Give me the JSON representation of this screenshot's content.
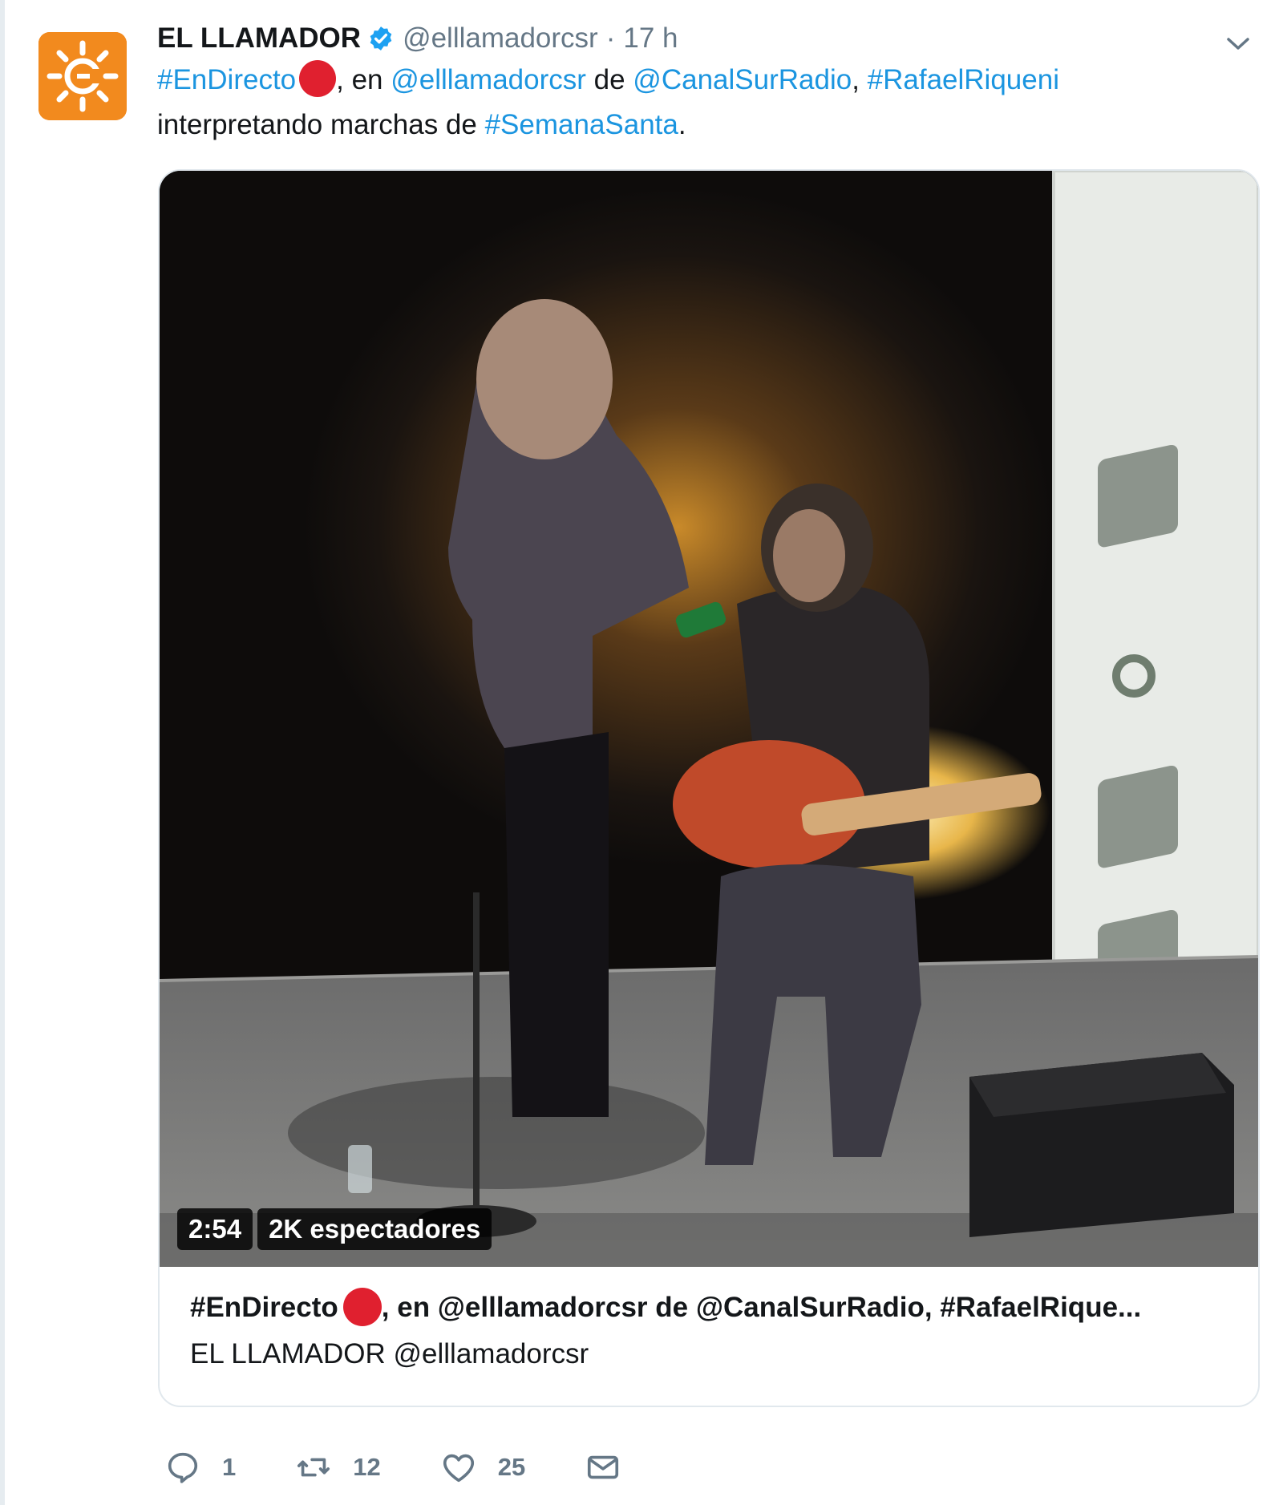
{
  "author": {
    "name": "EL LLAMADOR",
    "handle": "@elllamadorcsr",
    "time": "17 h",
    "separator": "·",
    "avatar_icon": "canal-sur-sun-logo-icon",
    "brand_color": "#f28a1e",
    "verified_color": "#1da1f2"
  },
  "tweet": {
    "hashtag_live": "#EnDirecto",
    "t1": ", en ",
    "mention_program": "@elllamadorcsr",
    "t2": " de ",
    "mention_station": "@CanalSurRadio",
    "t3": ", ",
    "hashtag_artist": "#RafaelRiqueni",
    "t4": "interpretando marchas de ",
    "hashtag_event": "#SemanaSanta",
    "t5": ".",
    "link_color": "#1b95e0",
    "live_dot_color": "#e0202f"
  },
  "video": {
    "duration": "2:54",
    "viewers": "2K espectadores"
  },
  "card": {
    "title_prefix": "#EnDirecto",
    "title_rest": ", en @elllamadorcsr de @CanalSurRadio, #RafaelRique...",
    "source": "EL LLAMADOR @elllamadorcsr"
  },
  "actions": {
    "replies": "1",
    "retweets": "12",
    "likes": "25"
  },
  "icons": {
    "reply": "reply-icon",
    "retweet": "retweet-icon",
    "like": "heart-icon",
    "dm": "envelope-icon",
    "more": "chevron-down-icon"
  }
}
